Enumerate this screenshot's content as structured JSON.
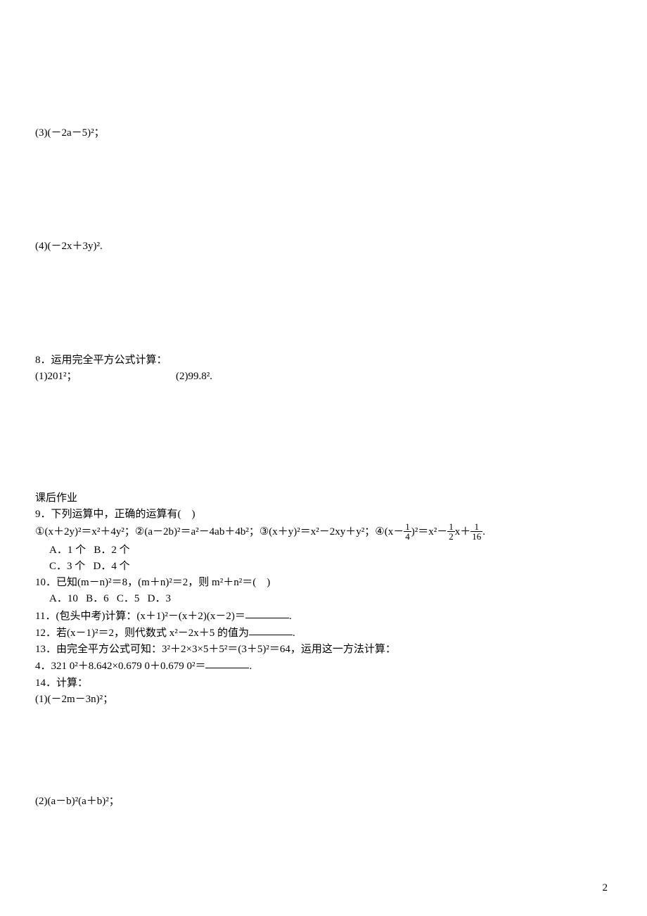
{
  "q7_3": "(3)(－2a－5)²；",
  "q7_4": "(4)(－2x＋3y)².",
  "q8_title": "8．运用完全平方公式计算：",
  "q8_1_label": "(1)201²；",
  "q8_2_label": "(2)99.8².",
  "section_after": "课后作业",
  "q9_stem": "9．下列运算中，正确的运算有(　)",
  "q9_opt1_pre": "①(x＋2y)²＝x²＋4y²；②(a－2b)²＝a²－4ab＋4b²；③(x＋y)²＝x²－2xy＋y²；④(x－",
  "q9_opt1_mid1": ")²＝x²－",
  "q9_opt1_mid2": "x＋",
  "q9_opt1_end": ".",
  "frac_1_4_n": "1",
  "frac_1_4_d": "4",
  "frac_1_2_n": "1",
  "frac_1_2_d": "2",
  "frac_1_16_n": "1",
  "frac_1_16_d": "16",
  "q9_A": "A．1 个",
  "q9_B": "B．2 个",
  "q9_C": "C．3 个",
  "q9_D": "D．4 个",
  "q10_stem": "10．已知(m－n)²＝8，(m＋n)²＝2，则 m²＋n²＝(　)",
  "q10_A": "A．10",
  "q10_B": "B．6",
  "q10_C": "C．5",
  "q10_D": "D．3",
  "q11_pre": "11．(包头中考)计算：(x＋1)²－(x＋2)(x－2)＝",
  "q11_post": ".",
  "q12_pre": "12．若(x－1)²＝2，则代数式 x²－2x＋5 的值为",
  "q12_post": ".",
  "q13_l1": "13．由完全平方公式可知：3²＋2×3×5＋5²＝(3＋5)²＝64，运用这一方法计算：",
  "q13_l2_pre": "4．321 0²＋8.642×0.679 0＋0.679 0²＝",
  "q13_l2_post": ".",
  "q14_title": "14．计算：",
  "q14_1": "(1)(－2m－3n)²；",
  "q14_2": "(2)(a－b)²(a＋b)²；",
  "page_number": "2"
}
